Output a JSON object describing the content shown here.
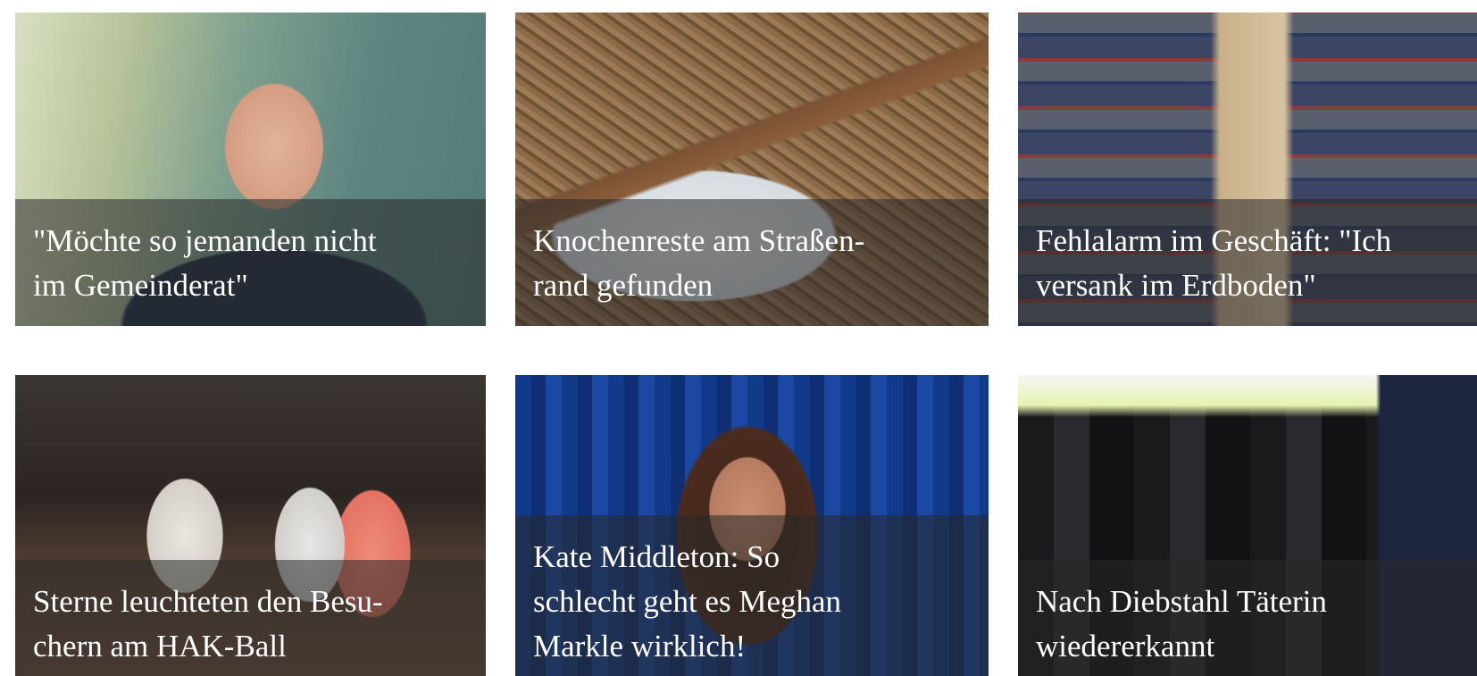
{
  "articles": [
    {
      "title": "\"Möchte so jemanden nicht\nim Gemeinderat\"",
      "image": "portrait of man with glasses"
    },
    {
      "title": "Knochenreste am Straßen-\nrand gefunden",
      "image": "bone in snowy dirt"
    },
    {
      "title": "Fehlalarm im Geschäft: \"Ich\nversank im Erdboden\"",
      "image": "supermarket aisle"
    },
    {
      "title": "Sterne leuchteten den Besu-\nchern am HAK-Ball",
      "image": "four girls at ball"
    },
    {
      "title": "Kate Middleton: So\nschlecht geht es Meghan\nMarkle wirklich!",
      "image": "woman in front of blue curtain"
    },
    {
      "title": "Nach Diebstahl Täterin\nwiedererkannt",
      "image": "jackets on rack"
    }
  ]
}
